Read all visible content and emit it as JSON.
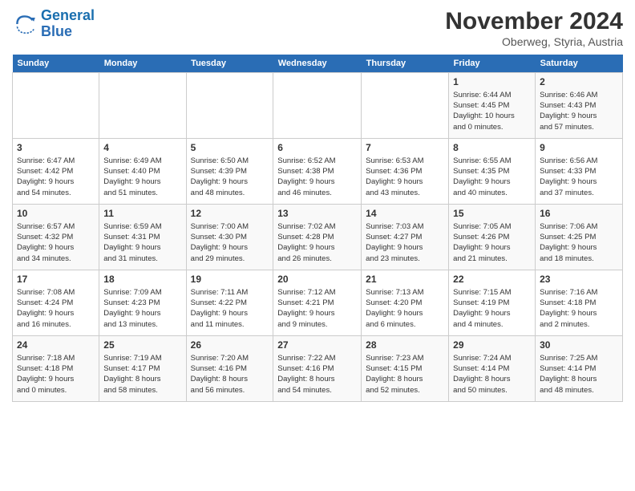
{
  "header": {
    "logo_line1": "General",
    "logo_line2": "Blue",
    "month": "November 2024",
    "location": "Oberweg, Styria, Austria"
  },
  "weekdays": [
    "Sunday",
    "Monday",
    "Tuesday",
    "Wednesday",
    "Thursday",
    "Friday",
    "Saturday"
  ],
  "weeks": [
    [
      {
        "day": "",
        "info": ""
      },
      {
        "day": "",
        "info": ""
      },
      {
        "day": "",
        "info": ""
      },
      {
        "day": "",
        "info": ""
      },
      {
        "day": "",
        "info": ""
      },
      {
        "day": "1",
        "info": "Sunrise: 6:44 AM\nSunset: 4:45 PM\nDaylight: 10 hours\nand 0 minutes."
      },
      {
        "day": "2",
        "info": "Sunrise: 6:46 AM\nSunset: 4:43 PM\nDaylight: 9 hours\nand 57 minutes."
      }
    ],
    [
      {
        "day": "3",
        "info": "Sunrise: 6:47 AM\nSunset: 4:42 PM\nDaylight: 9 hours\nand 54 minutes."
      },
      {
        "day": "4",
        "info": "Sunrise: 6:49 AM\nSunset: 4:40 PM\nDaylight: 9 hours\nand 51 minutes."
      },
      {
        "day": "5",
        "info": "Sunrise: 6:50 AM\nSunset: 4:39 PM\nDaylight: 9 hours\nand 48 minutes."
      },
      {
        "day": "6",
        "info": "Sunrise: 6:52 AM\nSunset: 4:38 PM\nDaylight: 9 hours\nand 46 minutes."
      },
      {
        "day": "7",
        "info": "Sunrise: 6:53 AM\nSunset: 4:36 PM\nDaylight: 9 hours\nand 43 minutes."
      },
      {
        "day": "8",
        "info": "Sunrise: 6:55 AM\nSunset: 4:35 PM\nDaylight: 9 hours\nand 40 minutes."
      },
      {
        "day": "9",
        "info": "Sunrise: 6:56 AM\nSunset: 4:33 PM\nDaylight: 9 hours\nand 37 minutes."
      }
    ],
    [
      {
        "day": "10",
        "info": "Sunrise: 6:57 AM\nSunset: 4:32 PM\nDaylight: 9 hours\nand 34 minutes."
      },
      {
        "day": "11",
        "info": "Sunrise: 6:59 AM\nSunset: 4:31 PM\nDaylight: 9 hours\nand 31 minutes."
      },
      {
        "day": "12",
        "info": "Sunrise: 7:00 AM\nSunset: 4:30 PM\nDaylight: 9 hours\nand 29 minutes."
      },
      {
        "day": "13",
        "info": "Sunrise: 7:02 AM\nSunset: 4:28 PM\nDaylight: 9 hours\nand 26 minutes."
      },
      {
        "day": "14",
        "info": "Sunrise: 7:03 AM\nSunset: 4:27 PM\nDaylight: 9 hours\nand 23 minutes."
      },
      {
        "day": "15",
        "info": "Sunrise: 7:05 AM\nSunset: 4:26 PM\nDaylight: 9 hours\nand 21 minutes."
      },
      {
        "day": "16",
        "info": "Sunrise: 7:06 AM\nSunset: 4:25 PM\nDaylight: 9 hours\nand 18 minutes."
      }
    ],
    [
      {
        "day": "17",
        "info": "Sunrise: 7:08 AM\nSunset: 4:24 PM\nDaylight: 9 hours\nand 16 minutes."
      },
      {
        "day": "18",
        "info": "Sunrise: 7:09 AM\nSunset: 4:23 PM\nDaylight: 9 hours\nand 13 minutes."
      },
      {
        "day": "19",
        "info": "Sunrise: 7:11 AM\nSunset: 4:22 PM\nDaylight: 9 hours\nand 11 minutes."
      },
      {
        "day": "20",
        "info": "Sunrise: 7:12 AM\nSunset: 4:21 PM\nDaylight: 9 hours\nand 9 minutes."
      },
      {
        "day": "21",
        "info": "Sunrise: 7:13 AM\nSunset: 4:20 PM\nDaylight: 9 hours\nand 6 minutes."
      },
      {
        "day": "22",
        "info": "Sunrise: 7:15 AM\nSunset: 4:19 PM\nDaylight: 9 hours\nand 4 minutes."
      },
      {
        "day": "23",
        "info": "Sunrise: 7:16 AM\nSunset: 4:18 PM\nDaylight: 9 hours\nand 2 minutes."
      }
    ],
    [
      {
        "day": "24",
        "info": "Sunrise: 7:18 AM\nSunset: 4:18 PM\nDaylight: 9 hours\nand 0 minutes."
      },
      {
        "day": "25",
        "info": "Sunrise: 7:19 AM\nSunset: 4:17 PM\nDaylight: 8 hours\nand 58 minutes."
      },
      {
        "day": "26",
        "info": "Sunrise: 7:20 AM\nSunset: 4:16 PM\nDaylight: 8 hours\nand 56 minutes."
      },
      {
        "day": "27",
        "info": "Sunrise: 7:22 AM\nSunset: 4:16 PM\nDaylight: 8 hours\nand 54 minutes."
      },
      {
        "day": "28",
        "info": "Sunrise: 7:23 AM\nSunset: 4:15 PM\nDaylight: 8 hours\nand 52 minutes."
      },
      {
        "day": "29",
        "info": "Sunrise: 7:24 AM\nSunset: 4:14 PM\nDaylight: 8 hours\nand 50 minutes."
      },
      {
        "day": "30",
        "info": "Sunrise: 7:25 AM\nSunset: 4:14 PM\nDaylight: 8 hours\nand 48 minutes."
      }
    ]
  ]
}
